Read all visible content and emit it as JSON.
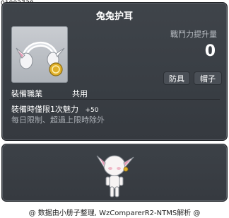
{
  "item": {
    "id": "01002738",
    "name": "兔兔护耳",
    "power_label": "戰鬥力提升量",
    "power_value": "0",
    "type_tags": [
      "防具",
      "帽子"
    ],
    "job_label": "裝備職業",
    "job_value": "共用",
    "effect_name": "裝備時僅限1次魅力",
    "effect_value": "+50",
    "limit_text": "每日限制、超過上限時除外",
    "icon": "earmuff-icon",
    "preview": "character-preview"
  },
  "footer": {
    "text": "@ 数据由小册子整理, WzComparerR2-NTMS解析 @"
  },
  "colors": {
    "panel_bg": "#3a3f45",
    "title": "#ffffff",
    "muted": "#a9aeb4",
    "ear_pink": "#e79ab6",
    "coin_gold": "#e0b02a"
  }
}
